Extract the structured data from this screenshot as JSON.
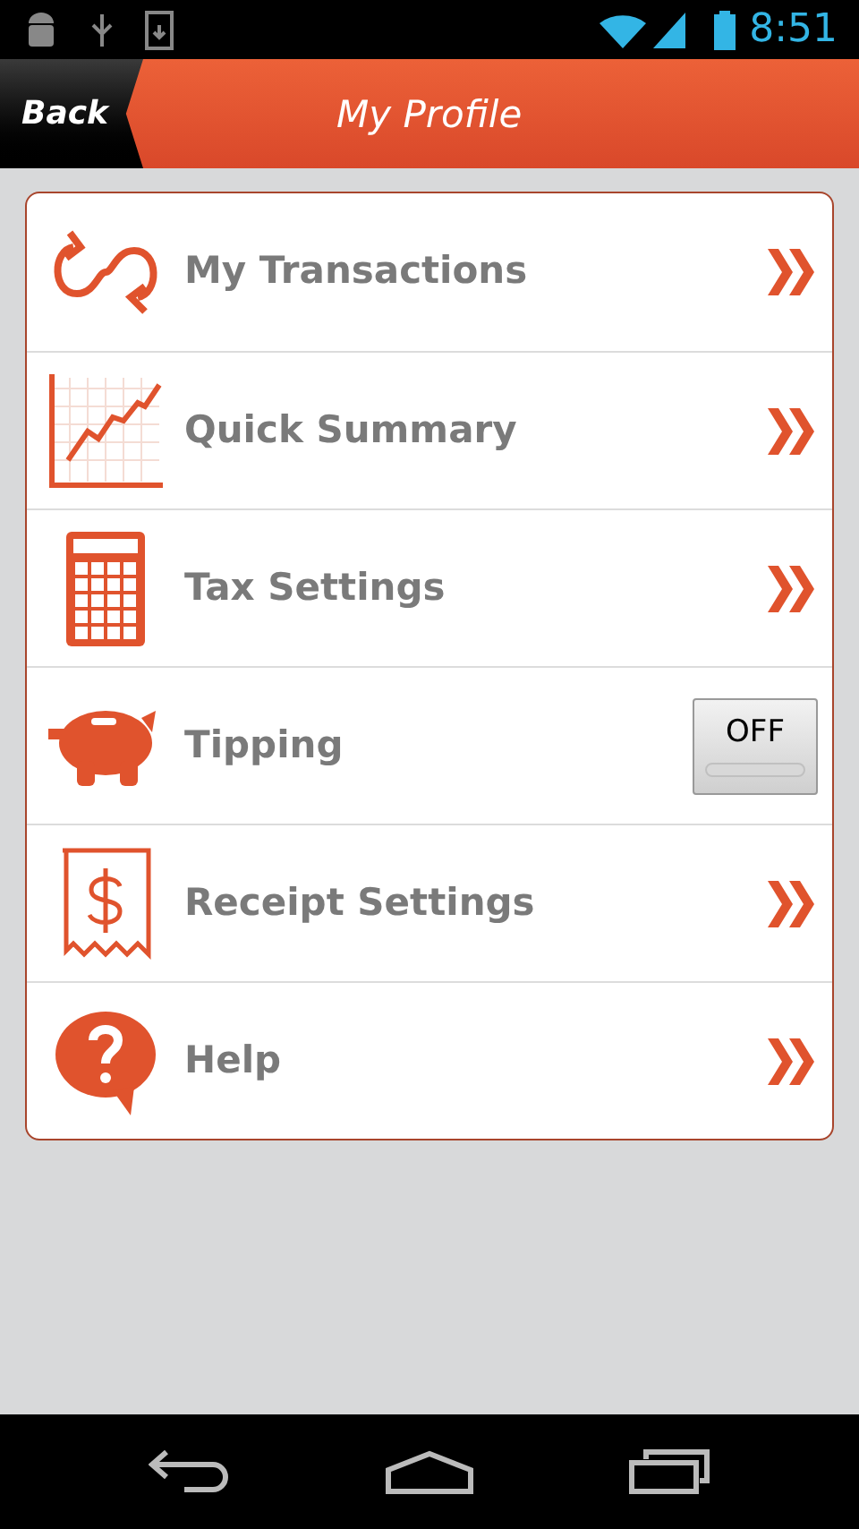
{
  "status_bar": {
    "time": "8:51"
  },
  "header": {
    "back": "Back",
    "title": "My Profile"
  },
  "items": [
    {
      "label": "My Transactions",
      "kind": "link"
    },
    {
      "label": "Quick Summary",
      "kind": "link"
    },
    {
      "label": "Tax Settings",
      "kind": "link"
    },
    {
      "label": "Tipping",
      "kind": "toggle",
      "on": false,
      "state_text": "OFF"
    },
    {
      "label": "Receipt Settings",
      "kind": "link"
    },
    {
      "label": "Help",
      "kind": "link"
    }
  ]
}
